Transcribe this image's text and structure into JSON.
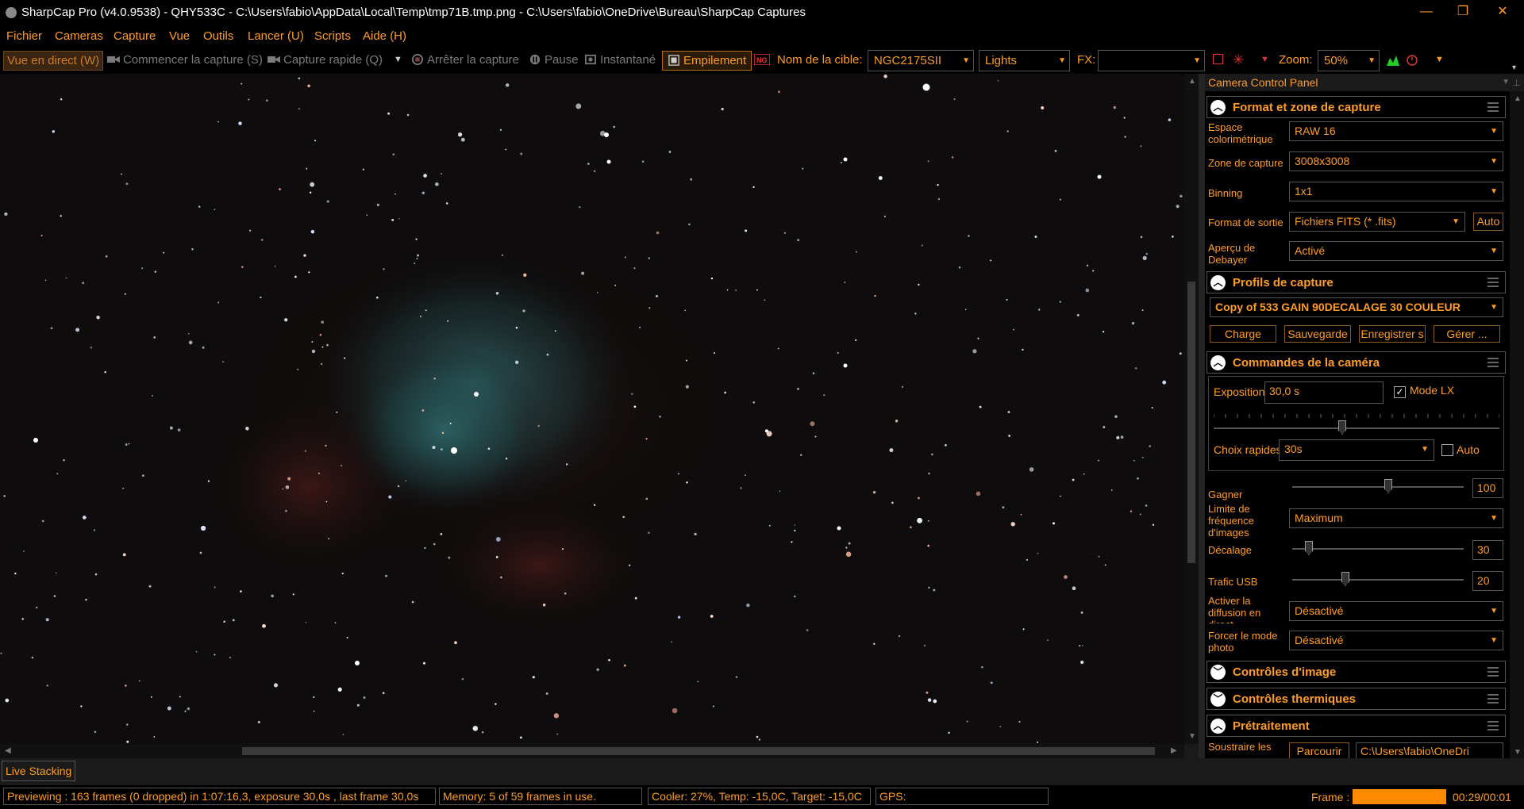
{
  "window": {
    "title": "SharpCap Pro (v4.0.9538) - QHY533C - C:\\Users\\fabio\\AppData\\Local\\Temp\\tmp71B.tmp.png - C:\\Users\\fabio\\OneDrive\\Bureau\\SharpCap Captures",
    "minimize": "—",
    "maximize": "❐",
    "close": "✕"
  },
  "menu": [
    "Fichier",
    "Cameras",
    "Capture",
    "Vue",
    "Outils",
    "Lancer (U)",
    "Scripts",
    "Aide (H)"
  ],
  "toolbar": {
    "live_view": "Vue en direct (W)",
    "start_capture": "Commencer la capture (S)",
    "quick_capture": "Capture rapide (Q)",
    "stop_capture": "Arrêter la capture",
    "pause": "Pause",
    "snapshot": "Instantané",
    "stacking": "Empilement",
    "target_label": "Nom de la cible:",
    "target_value": "NGC2175SII",
    "frame_type": "Lights",
    "fx_label": "FX:",
    "fx_value": "",
    "zoom_label": "Zoom:",
    "zoom_value": "50%"
  },
  "panel": {
    "title": "Camera Control Panel",
    "format": {
      "title": "Format et zone de capture",
      "color_space_label": "Espace colorimétrique",
      "color_space": "RAW 16",
      "capture_area_label": "Zone de capture",
      "capture_area": "3008x3008",
      "binning_label": "Binning",
      "binning": "1x1",
      "output_format_label": "Format de sortie",
      "output_format": "Fichiers FITS (* .fits)",
      "output_auto": "Auto",
      "debayer_label": "Aperçu de Debayer",
      "debayer": "Activé"
    },
    "profiles": {
      "title": "Profils de capture",
      "selected": "Copy of 533 GAIN 90DECALAGE 30 COULEUR",
      "load": "Charge",
      "save": "Sauvegarde",
      "save_as": "Enregistrer s",
      "manage": "Gérer ..."
    },
    "camera": {
      "title": "Commandes de la caméra",
      "exposure_label": "Exposition",
      "exposure": "30,0 s",
      "lx_label": "Mode LX",
      "lx_checked": true,
      "quick_label": "Choix rapides",
      "quick": "30s",
      "quick_auto": "Auto",
      "gain_label": "Gagner",
      "gain": "100",
      "framerate_label": "Limite de fréquence d'images",
      "framerate": "Maximum",
      "offset_label": "Décalage",
      "offset": "30",
      "usb_label": "Trafic USB",
      "usb": "20",
      "stream_label": "Activer la diffusion en direct",
      "stream": "Désactivé",
      "photo_label": "Forcer le mode photo",
      "photo": "Désactivé"
    },
    "image_controls": "Contrôles d'image",
    "thermal_controls": "Contrôles thermiques",
    "preprocessing": {
      "title": "Prétraitement",
      "subtract_label": "Soustraire les",
      "browse": "Parcourir",
      "path": "C:\\Users\\fabio\\OneDri"
    }
  },
  "tabs": {
    "live_stacking": "Live Stacking"
  },
  "status": {
    "previewing": "Previewing : 163 frames (0 dropped) in 1:07:16,3, exposure 30,0s , last frame 30,0s",
    "memory": "Memory: 5 of 59 frames in use.",
    "cooler": "Cooler: 27%, Temp: -15,0C, Target: -15,0C",
    "gps": "GPS:",
    "frame_label": "Frame :",
    "frame_progress": 1.0,
    "frame_time": "00:29/00:01"
  },
  "colors": {
    "accent": "#ff9c28",
    "background": "#000000",
    "nebula_teal": "#2a6a6a",
    "nebula_red": "#5a1e1e"
  }
}
